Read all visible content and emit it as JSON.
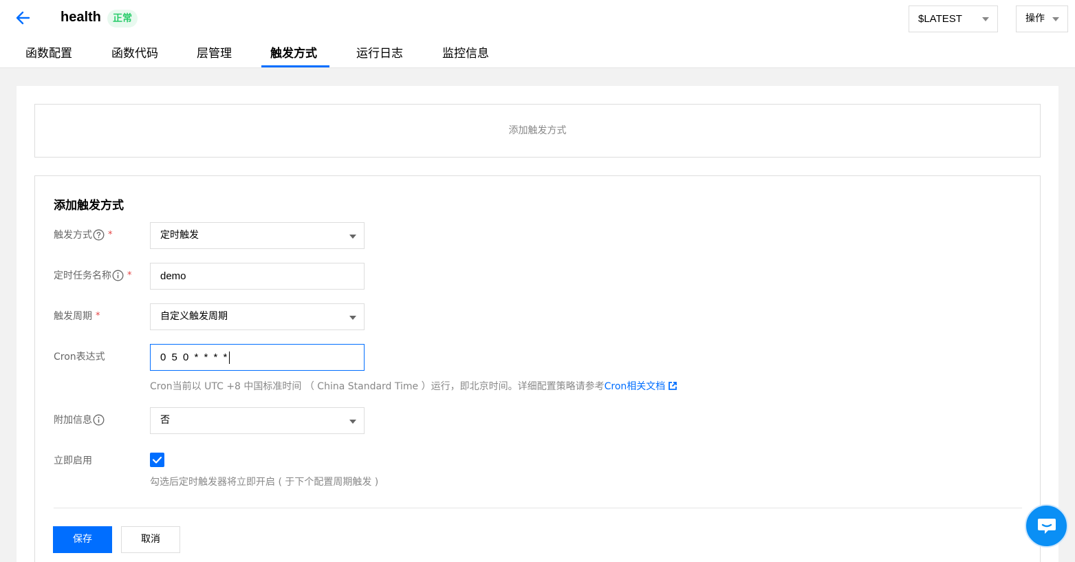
{
  "header": {
    "function_name": "health",
    "status": "正常",
    "version": "$LATEST",
    "ops_label": "操作"
  },
  "tabs": [
    {
      "label": "函数配置"
    },
    {
      "label": "函数代码"
    },
    {
      "label": "层管理"
    },
    {
      "label": "触发方式",
      "active": true
    },
    {
      "label": "运行日志"
    },
    {
      "label": "监控信息"
    }
  ],
  "add_trigger_link": "添加触发方式",
  "form": {
    "title": "添加触发方式",
    "trigger_type": {
      "label": "触发方式",
      "value": "定时触发",
      "required": "*"
    },
    "task_name": {
      "label": "定时任务名称",
      "value": "demo",
      "required": "*"
    },
    "period": {
      "label": "触发周期",
      "value": "自定义触发周期",
      "required": "*"
    },
    "cron": {
      "label": "Cron表达式",
      "value": "0 5 0 * * * *",
      "hint": "Cron当前以 UTC +8 中国标准时间 （ China Standard Time ）运行，即北京时间。详细配置策略请参考",
      "hint_link": "Cron相关文档"
    },
    "extra_info": {
      "label": "附加信息",
      "value": "否"
    },
    "enable_now": {
      "label": "立即启用",
      "checked": true,
      "hint": "勾选后定时触发器将立即开启 ( 于下个配置周期触发 )"
    },
    "save_label": "保存",
    "cancel_label": "取消"
  },
  "colors": {
    "accent": "#006eff",
    "status_green": "#29cc6a",
    "required_red": "#e54545"
  },
  "icons": [
    "back-arrow-icon",
    "help-question-icon",
    "info-icon",
    "external-link-icon",
    "checkmark-icon",
    "chat-icon"
  ]
}
